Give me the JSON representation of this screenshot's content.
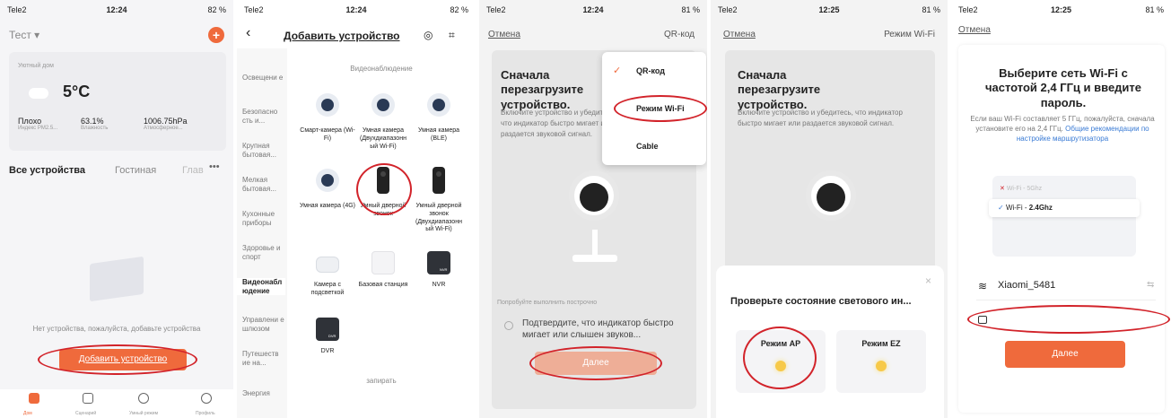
{
  "s1": {
    "carrier": "Tele2",
    "time": "12:24",
    "battery": "82 %",
    "home": "Тест",
    "home_label": "Уютный дом",
    "temp": "5°C",
    "stats": [
      {
        "v": "Плохо",
        "l": "Индекс PM2.5..."
      },
      {
        "v": "63.1%",
        "l": "Влажность"
      },
      {
        "v": "1006.75hPa",
        "l": "Атмосферное..."
      }
    ],
    "tabs": [
      "Все устройства",
      "Гостиная",
      "Глав"
    ],
    "empty": "Нет устройства, пожалуйста, добавьте устройства",
    "add_btn": "Добавить устройство",
    "nav": [
      "Дом",
      "Сценарий",
      "Умный режим",
      "Профиль"
    ]
  },
  "s2": {
    "carrier": "Tele2",
    "time": "12:24",
    "battery": "82 %",
    "title": "Добавить устройство",
    "categories": [
      "Освещени е",
      "Безопасно сть и...",
      "Крупная бытовая...",
      "Мелкая бытовая...",
      "Кухонные приборы",
      "Здоровье и спорт",
      "Видеонабл юдение",
      "Управлени е шлюзом",
      "Путешеств ие на...",
      "Энергия"
    ],
    "section": "Видеонаблюдение",
    "devices": [
      "Смарт-камера (Wi-Fi)",
      "Умная камера (Двухдиапазонн ый Wi-Fi)",
      "Умная камера (BLE)",
      "Умная камера (4G)",
      "Умный дверной звонок",
      "Умный дверной звонок (Двухдиапазонн ый Wi-Fi)",
      "Камера с подсветкой",
      "Базовая станция",
      "NVR",
      "DVR"
    ],
    "section2": "запирать",
    "nvr_tag": "NVR",
    "dvr_tag": "DVR"
  },
  "s3": {
    "carrier": "Tele2",
    "time": "12:24",
    "battery": "81 %",
    "cancel": "Отмена",
    "mode": "QR-код",
    "heading": "Сначала перезагрузите устройство.",
    "desc": "Включите устройство и убедитесь, что индикатор быстро мигает или раздается звуковой сигнал.",
    "menu": [
      "QR-код",
      "Режим Wi-Fi",
      "Cable"
    ],
    "hint": "Попробуйте выполнить построчно",
    "confirm": "Подтвердите, что индикатор быстро мигает или слышен звуков...",
    "next": "Далее"
  },
  "s4": {
    "carrier": "Tele2",
    "time": "12:25",
    "battery": "81 %",
    "cancel": "Отмена",
    "mode": "Режим Wi-Fi",
    "heading": "Сначала перезагрузите устройство.",
    "desc": "Включите устройство и убедитесь, что индикатор быстро мигает или раздается звуковой сигнал.",
    "sheet_title": "Проверьте состояние светового ин...",
    "opt_ap": "Режим AP",
    "opt_ez": "Режим EZ"
  },
  "s5": {
    "carrier": "Tele2",
    "time": "12:25",
    "battery": "81 %",
    "cancel": "Отмена",
    "title": "Выберите сеть Wi-Fi с частотой 2,4 ГГц и введите пароль.",
    "desc": "Если ваш Wi-Fi составляет 5 ГГц, пожалуйста, сначала установите его на 2,4 ГГц.",
    "link": "Общие рекомендации по настройке маршрутизатора",
    "bad": "Wi-Fi - 5Ghz",
    "good_prefix": "Wi-Fi - ",
    "good": "2.4Ghz",
    "ssid": "Xiaomi_5481",
    "next": "Далее"
  },
  "colors": {
    "accent": "#ef6a3c",
    "annotation": "#d2232a",
    "link": "#3a7bd5"
  }
}
